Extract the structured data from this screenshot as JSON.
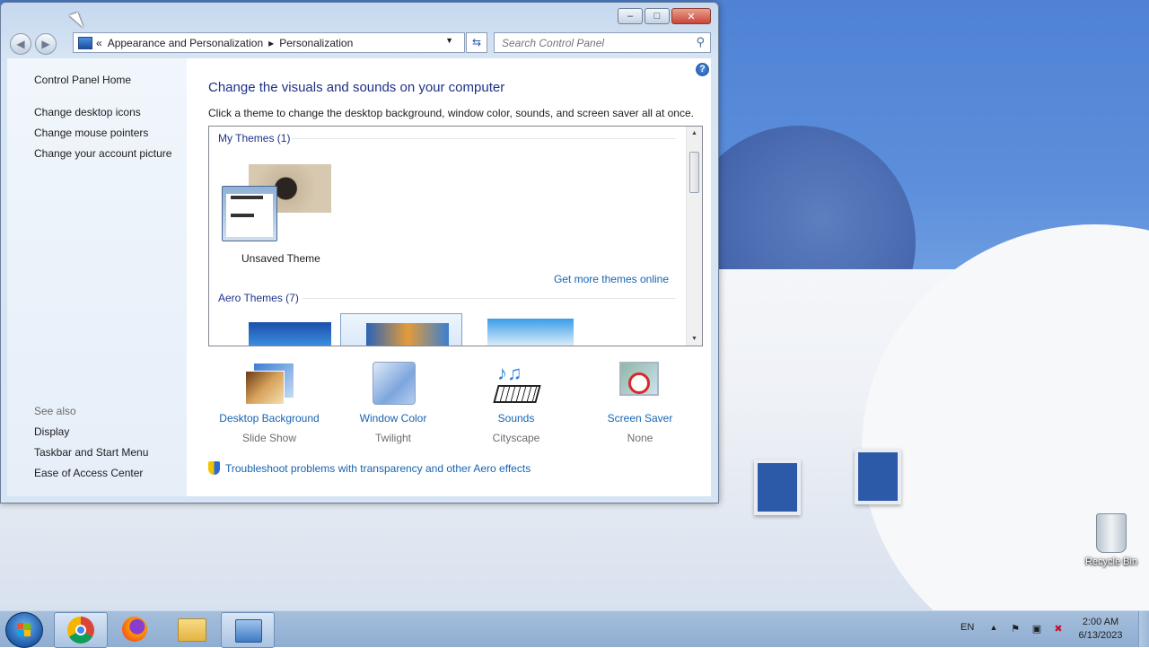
{
  "window": {
    "breadcrumb": [
      "Appearance and Personalization",
      "Personalization"
    ],
    "breadcrumb_prefix": "«",
    "search_placeholder": "Search Control Panel",
    "caption": {
      "minimize": "–",
      "maximize": "□",
      "close": "✕"
    }
  },
  "sidebar": {
    "home": "Control Panel Home",
    "links": [
      "Change desktop icons",
      "Change mouse pointers",
      "Change your account picture"
    ],
    "see_also_label": "See also",
    "see_also": [
      "Display",
      "Taskbar and Start Menu",
      "Ease of Access Center"
    ]
  },
  "main": {
    "title": "Change the visuals and sounds on your computer",
    "subtitle": "Click a theme to change the desktop background, window color, sounds, and screen saver all at once.",
    "my_themes_header": "My Themes (1)",
    "my_theme_name": "Unsaved Theme",
    "get_more": "Get more themes online",
    "aero_themes_header": "Aero Themes (7)",
    "options": [
      {
        "label": "Desktop Background",
        "value": "Slide Show",
        "icon": "desktop-background-icon"
      },
      {
        "label": "Window Color",
        "value": "Twilight",
        "icon": "window-color-icon"
      },
      {
        "label": "Sounds",
        "value": "Cityscape",
        "icon": "sounds-icon"
      },
      {
        "label": "Screen Saver",
        "value": "None",
        "icon": "screen-saver-icon"
      }
    ],
    "troubleshoot": "Troubleshoot problems with transparency and other Aero effects"
  },
  "desktop": {
    "recycle_bin": "Recycle Bin"
  },
  "taskbar": {
    "apps": [
      "chrome-icon",
      "firefox-icon",
      "file-explorer-icon",
      "control-panel-icon"
    ],
    "language": "EN",
    "time": "2:00 AM",
    "date": "6/13/2023"
  }
}
